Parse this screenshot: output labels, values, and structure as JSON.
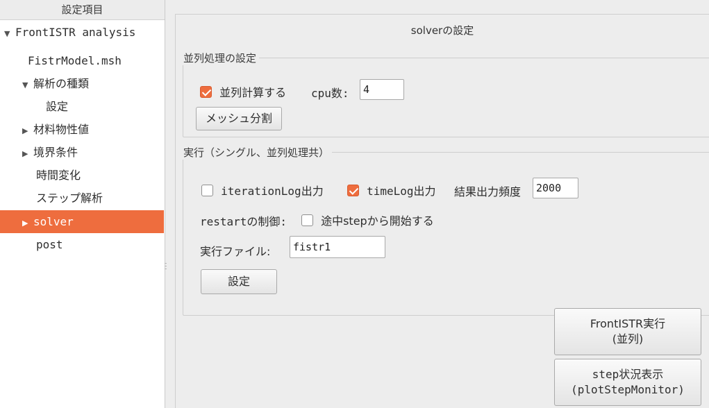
{
  "tree": {
    "header": "設定項目",
    "items": [
      {
        "label": "FrontISTR analysis",
        "arrow": "▼"
      },
      {
        "label": "FistrModel.msh",
        "arrow": ""
      },
      {
        "label": "解析の種類",
        "arrow": "▼"
      },
      {
        "label": "設定",
        "arrow": ""
      },
      {
        "label": "材料物性値",
        "arrow": "▶"
      },
      {
        "label": "境界条件",
        "arrow": "▶"
      },
      {
        "label": "時間変化",
        "arrow": ""
      },
      {
        "label": "ステップ解析",
        "arrow": ""
      },
      {
        "label": "solver",
        "arrow": "▶"
      },
      {
        "label": "post",
        "arrow": ""
      }
    ],
    "selected_index": 8
  },
  "panel": {
    "title": "solverの設定"
  },
  "parallel_group": {
    "legend": "並列処理の設定",
    "parallel_checkbox_label": "並列計算する",
    "parallel_checked": true,
    "cpu_label": "cpu数:",
    "cpu_value": "4",
    "mesh_split_button": "メッシュ分割"
  },
  "exec_group": {
    "legend": "実行（シングル、並列処理共）",
    "iteration_log_label": "iterationLog出力",
    "iteration_log_checked": false,
    "time_log_label": "timeLog出力",
    "time_log_checked": true,
    "result_freq_label": "結果出力頻度",
    "result_freq_value": "2000",
    "restart_label": "restartの制御:",
    "restart_checkbox_label": "途中stepから開始する",
    "restart_checked": false,
    "exec_file_label": "実行ファイル:",
    "exec_file_value": "fistr1",
    "set_button": "設定"
  },
  "run_button": {
    "line1": "FrontISTR実行",
    "line2": "(並列)"
  },
  "monitor_button": {
    "line1": "step状況表示",
    "line2": "(plotStepMonitor)"
  },
  "colors": {
    "accent": "#ee6d3e",
    "panel_bg": "#ededed",
    "tree_bg": "#ffffff"
  }
}
